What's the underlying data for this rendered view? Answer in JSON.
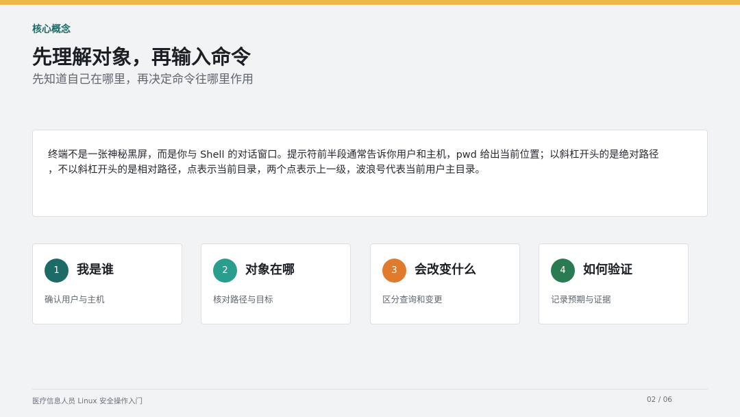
{
  "header": {
    "kicker": "核心概念",
    "title": "先理解对象，再输入命令",
    "subtitle": "先知道自己在哪里，再决定命令往哪里作用"
  },
  "intro": {
    "line1": "终端不是一张神秘黑屏，而是你与 Shell 的对话窗口。提示符前半段通常告诉你用户和主机，pwd 给出当前位置；以斜杠开头的是绝对路径",
    "line2": "，不以斜杠开头的是相对路径，点表示当前目录，两个点表示上一级，波浪号代表当前用户主目录。"
  },
  "steps": [
    {
      "number": "1",
      "title": "我是谁",
      "desc": "确认用户与主机",
      "color": "#1d6b66"
    },
    {
      "number": "2",
      "title": "对象在哪",
      "desc": "核对路径与目标",
      "color": "#2a9d8f"
    },
    {
      "number": "3",
      "title": "会改变什么",
      "desc": "区分查询和变更",
      "color": "#e07a2c"
    },
    {
      "number": "4",
      "title": "如何验证",
      "desc": "记录预期与证据",
      "color": "#2a7a52"
    }
  ],
  "footer": {
    "course": "医疗信息人员 Linux 安全操作入门",
    "page": "02 / 06"
  },
  "colors": {
    "accent_bar": "#ecb84a",
    "kicker": "#1d6b66"
  }
}
